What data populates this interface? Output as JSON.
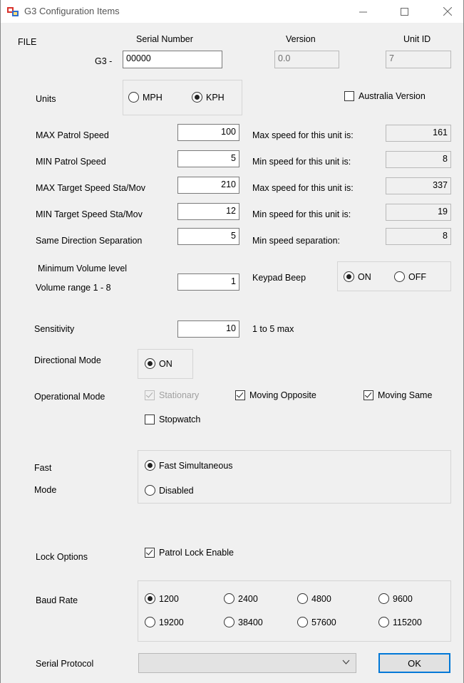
{
  "window": {
    "title": "G3 Configuration Items",
    "menu_file": "FILE"
  },
  "header": {
    "serial_label": "Serial Number",
    "serial_prefix": "G3 -",
    "serial_value": "00000",
    "version_label": "Version",
    "version_value": "0.0",
    "unit_id_label": "Unit ID",
    "unit_id_value": "7"
  },
  "units": {
    "label": "Units",
    "options": [
      "MPH",
      "KPH"
    ],
    "selected": "KPH",
    "australia_label": "Australia Version",
    "australia_checked": false
  },
  "speeds": [
    {
      "label": "MAX Patrol Speed",
      "value": "100",
      "info_label": "Max speed for this unit is:",
      "info_value": "161"
    },
    {
      "label": "MIN Patrol Speed",
      "value": "5",
      "info_label": "Min speed for this unit is:",
      "info_value": "8"
    },
    {
      "label": "MAX Target Speed Sta/Mov",
      "value": "210",
      "info_label": "Max speed for this unit is:",
      "info_value": "337"
    },
    {
      "label": "MIN Target Speed Sta/Mov",
      "value": "12",
      "info_label": "Min speed for this unit is:",
      "info_value": "19"
    },
    {
      "label": "Same Direction Separation",
      "value": "5",
      "info_label": "Min speed separation:",
      "info_value": "8"
    }
  ],
  "volume": {
    "label_line1": "Minimum Volume level",
    "label_line2": "Volume range 1 - 8",
    "value": "1"
  },
  "keypad_beep": {
    "label": "Keypad Beep",
    "options": [
      "ON",
      "OFF"
    ],
    "selected": "ON"
  },
  "sensitivity": {
    "label": "Sensitivity",
    "value": "10",
    "hint": "1 to 5 max"
  },
  "directional_mode": {
    "label": "Directional Mode",
    "option": "ON",
    "selected": true
  },
  "operational_mode": {
    "label": "Operational Mode",
    "stationary": "Stationary",
    "moving_opposite": "Moving Opposite",
    "moving_same": "Moving Same",
    "stopwatch": "Stopwatch"
  },
  "fast_mode": {
    "label_line1": "Fast",
    "label_line2": "Mode",
    "options": [
      "Fast Simultaneous",
      "Disabled"
    ],
    "selected": "Fast Simultaneous"
  },
  "lock_options": {
    "label": "Lock Options",
    "patrol_lock": "Patrol Lock Enable",
    "patrol_lock_checked": true
  },
  "baud_rate": {
    "label": "Baud Rate",
    "options": [
      "1200",
      "2400",
      "4800",
      "9600",
      "19200",
      "38400",
      "57600",
      "115200"
    ],
    "selected": "1200"
  },
  "serial_protocol": {
    "label": "Serial Protocol",
    "value": ""
  },
  "ok_button": "OK"
}
